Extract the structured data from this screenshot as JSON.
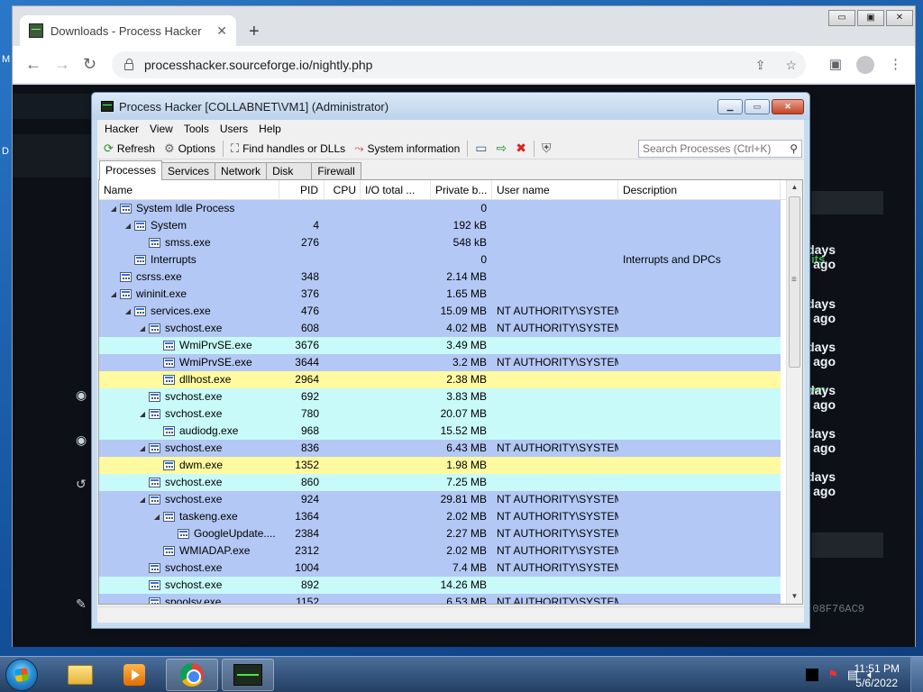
{
  "desktop": {
    "edge_m": "M",
    "edge_d": "D"
  },
  "browser": {
    "tab_title": "Downloads - Process Hacker",
    "url": "processhacker.sourceforge.io/nightly.php",
    "controls": {
      "minimize": "▭",
      "restore": "▣",
      "close": "✕"
    }
  },
  "page_behind": {
    "times": [
      {
        "a": "3 days",
        "b": "ago"
      },
      {
        "a": "3 days",
        "b": "ago"
      },
      {
        "a": "3 days",
        "b": "ago"
      },
      {
        "a": "3 days",
        "b": "ago"
      },
      {
        "a": "3 days",
        "b": "ago"
      },
      {
        "a": "3 days",
        "b": "ago"
      }
    ],
    "green_a": "its",
    "green_b": "wn",
    "hash": "08F76AC9",
    "side_c": "C"
  },
  "processhacker": {
    "title": "Process Hacker [COLLABNET\\VM1] (Administrator)",
    "menu": [
      "Hacker",
      "View",
      "Tools",
      "Users",
      "Help"
    ],
    "toolbar": {
      "refresh": "Refresh",
      "options": "Options",
      "find_handles": "Find handles or DLLs",
      "system_info": "System information"
    },
    "search_placeholder": "Search Processes (Ctrl+K)",
    "tabs": [
      "Processes",
      "Services",
      "Network",
      "Disk",
      "Firewall"
    ],
    "columns": [
      "Name",
      "PID",
      "CPU",
      "I/O total ...",
      "Private b...",
      "User name",
      "Description"
    ],
    "colors": {
      "system": "#b4c8f5",
      "service": "#c8fafa",
      "own": "#fffaa0",
      "selected_text": "#000000"
    },
    "processes": [
      {
        "name": "System Idle Process",
        "pid": "",
        "priv": "0",
        "user": "",
        "desc": "",
        "level": 0,
        "exp": "◢",
        "kind": "system"
      },
      {
        "name": "System",
        "pid": "4",
        "priv": "192 kB",
        "user": "",
        "desc": "",
        "level": 1,
        "exp": "◢",
        "kind": "system"
      },
      {
        "name": "smss.exe",
        "pid": "276",
        "priv": "548 kB",
        "user": "",
        "desc": "",
        "level": 2,
        "exp": "",
        "kind": "system"
      },
      {
        "name": "Interrupts",
        "pid": "",
        "priv": "0",
        "user": "",
        "desc": "Interrupts and DPCs",
        "level": 1,
        "exp": "",
        "kind": "system"
      },
      {
        "name": "csrss.exe",
        "pid": "348",
        "priv": "2.14 MB",
        "user": "",
        "desc": "",
        "level": 0,
        "exp": "",
        "kind": "system"
      },
      {
        "name": "wininit.exe",
        "pid": "376",
        "priv": "1.65 MB",
        "user": "",
        "desc": "",
        "level": 0,
        "exp": "◢",
        "kind": "system"
      },
      {
        "name": "services.exe",
        "pid": "476",
        "priv": "15.09 MB",
        "user": "NT AUTHORITY\\SYSTEM",
        "desc": "",
        "level": 1,
        "exp": "◢",
        "kind": "system"
      },
      {
        "name": "svchost.exe",
        "pid": "608",
        "priv": "4.02 MB",
        "user": "NT AUTHORITY\\SYSTEM",
        "desc": "",
        "level": 2,
        "exp": "◢",
        "kind": "system"
      },
      {
        "name": "WmiPrvSE.exe",
        "pid": "3676",
        "priv": "3.49 MB",
        "user": "",
        "desc": "",
        "level": 3,
        "exp": "",
        "kind": "service"
      },
      {
        "name": "WmiPrvSE.exe",
        "pid": "3644",
        "priv": "3.2 MB",
        "user": "NT AUTHORITY\\SYSTEM",
        "desc": "",
        "level": 3,
        "exp": "",
        "kind": "system"
      },
      {
        "name": "dllhost.exe",
        "pid": "2964",
        "priv": "2.38 MB",
        "user": "",
        "desc": "",
        "level": 3,
        "exp": "",
        "kind": "own"
      },
      {
        "name": "svchost.exe",
        "pid": "692",
        "priv": "3.83 MB",
        "user": "",
        "desc": "",
        "level": 2,
        "exp": "",
        "kind": "service"
      },
      {
        "name": "svchost.exe",
        "pid": "780",
        "priv": "20.07 MB",
        "user": "",
        "desc": "",
        "level": 2,
        "exp": "◢",
        "kind": "service"
      },
      {
        "name": "audiodg.exe",
        "pid": "968",
        "priv": "15.52 MB",
        "user": "",
        "desc": "",
        "level": 3,
        "exp": "",
        "kind": "service"
      },
      {
        "name": "svchost.exe",
        "pid": "836",
        "priv": "6.43 MB",
        "user": "NT AUTHORITY\\SYSTEM",
        "desc": "",
        "level": 2,
        "exp": "◢",
        "kind": "system"
      },
      {
        "name": "dwm.exe",
        "pid": "1352",
        "priv": "1.98 MB",
        "user": "",
        "desc": "",
        "level": 3,
        "exp": "",
        "kind": "own"
      },
      {
        "name": "svchost.exe",
        "pid": "860",
        "priv": "7.25 MB",
        "user": "",
        "desc": "",
        "level": 2,
        "exp": "",
        "kind": "service"
      },
      {
        "name": "svchost.exe",
        "pid": "924",
        "priv": "29.81 MB",
        "user": "NT AUTHORITY\\SYSTEM",
        "desc": "",
        "level": 2,
        "exp": "◢",
        "kind": "system"
      },
      {
        "name": "taskeng.exe",
        "pid": "1364",
        "priv": "2.02 MB",
        "user": "NT AUTHORITY\\SYSTEM",
        "desc": "",
        "level": 3,
        "exp": "◢",
        "kind": "system"
      },
      {
        "name": "GoogleUpdate....",
        "pid": "2384",
        "priv": "2.27 MB",
        "user": "NT AUTHORITY\\SYSTEM",
        "desc": "",
        "level": 4,
        "exp": "",
        "kind": "system"
      },
      {
        "name": "WMIADAP.exe",
        "pid": "2312",
        "priv": "2.02 MB",
        "user": "NT AUTHORITY\\SYSTEM",
        "desc": "",
        "level": 3,
        "exp": "",
        "kind": "system"
      },
      {
        "name": "svchost.exe",
        "pid": "1004",
        "priv": "7.4 MB",
        "user": "NT AUTHORITY\\SYSTEM",
        "desc": "",
        "level": 2,
        "exp": "",
        "kind": "system"
      },
      {
        "name": "svchost.exe",
        "pid": "892",
        "priv": "14.26 MB",
        "user": "",
        "desc": "",
        "level": 2,
        "exp": "",
        "kind": "service"
      },
      {
        "name": "spoolsv.exe",
        "pid": "1152",
        "priv": "6.53 MB",
        "user": "NT AUTHORITY\\SYSTEM",
        "desc": "",
        "level": 2,
        "exp": "",
        "kind": "system"
      }
    ]
  },
  "taskbar": {
    "time": "11:51 PM",
    "date": "5/6/2022"
  }
}
